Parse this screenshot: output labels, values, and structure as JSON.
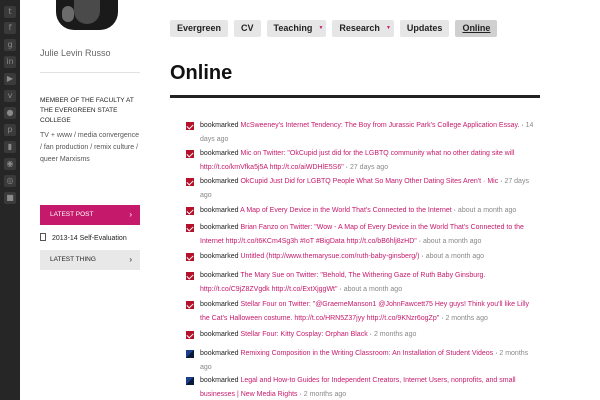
{
  "sidebar": {
    "name": "Julie Levin Russo",
    "description": "MEMBER OF THE FACULTY AT THE EVERGREEN STATE COLLEGE",
    "tagline": "TV + www / media convergence / fan production / remix culture / queer Marxisms",
    "latest_post_label": "LATEST POST",
    "latest_post_item": "2013-14 Self-Evaluation",
    "latest_thing_label": "LATEST THING"
  },
  "nav": {
    "items": [
      {
        "label": "Evergreen"
      },
      {
        "label": "CV"
      },
      {
        "label": "Teaching"
      },
      {
        "label": "Research"
      },
      {
        "label": "Updates"
      },
      {
        "label": "Online"
      }
    ]
  },
  "page": {
    "title": "Online"
  },
  "feed": [
    {
      "action": "bookmarked",
      "title": "McSweeney's Internet Tendency: The Boy from Jurassic Park's College Application Essay.",
      "time": "14 days ago",
      "icon": "red"
    },
    {
      "action": "bookmarked",
      "title": "Mic on Twitter: \"OkCupid just did for the LGBTQ community what no other dating site will http://t.co/kmVfka5j5A http://t.co/aiWDHlE5S6\"",
      "time": "27 days ago",
      "icon": "red"
    },
    {
      "action": "bookmarked",
      "title": "OkCupid Just Did for LGBTQ People What So Many Other Dating Sites Aren't · Mic",
      "time": "27 days ago",
      "icon": "red"
    },
    {
      "action": "bookmarked",
      "title": "A Map of Every Device in the World That's Connected to the Internet",
      "time": "about a month ago",
      "icon": "red"
    },
    {
      "action": "bookmarked",
      "title": "Brian Fanzo on Twitter: \"Wow - A Map of Every Device in the World That's Connected to the Internet http://t.co/t6KCm4Sg3h #IoT #BigData http://t.co/bB6hlj8zHD\"",
      "time": "about a month ago",
      "icon": "red"
    },
    {
      "action": "bookmarked",
      "title": "Untitled (http://www.themarysue.com/ruth-baby-ginsberg/)",
      "time": "about a month ago",
      "icon": "red"
    },
    {
      "action": "bookmarked",
      "title": "The Mary Sue on Twitter: \"Behold, The Withering Gaze of Ruth Baby Ginsburg. http://t.co/C9jZ8ZVgdk http://t.co/ExtXjggWt\"",
      "time": "about a month ago",
      "icon": "red"
    },
    {
      "action": "bookmarked",
      "title": "Stellar Four on Twitter: \"@GraemeManson1 @JohnFawcett75 Hey guys! Think you'll like Lilly the Cat's Halloween costume. http://t.co/HRN5Z37jyy http://t.co/9KNzr6ogZp\"",
      "time": "2 months ago",
      "icon": "red"
    },
    {
      "action": "bookmarked",
      "title": "Stellar Four: Kitty Cosplay: Orphan Black",
      "time": "2 months ago",
      "icon": "red"
    },
    {
      "action": "bookmarked",
      "title": "Remixing Composition in the Writing Classroom: An Installation of Student Videos",
      "time": "2 months ago",
      "icon": "blue"
    },
    {
      "action": "bookmarked",
      "title": "Legal and How-to Guides for Independent Creators, Internet Users, nonprofits, and small businesses | New Media Rights",
      "time": "2 months ago",
      "icon": "blue"
    }
  ],
  "colors": {
    "accent": "#c51a6c",
    "iconbar": "#262626",
    "entry_icon_red": "#b3122a",
    "entry_icon_blue": "#1d3d8f"
  },
  "icons": [
    "twitter-icon",
    "facebook-icon",
    "google-plus-icon",
    "linkedin-icon",
    "youtube-icon",
    "vimeo-icon",
    "flickr-icon",
    "pinterest-icon",
    "bookmark-icon",
    "rss-icon",
    "github-icon",
    "delicious-icon"
  ]
}
